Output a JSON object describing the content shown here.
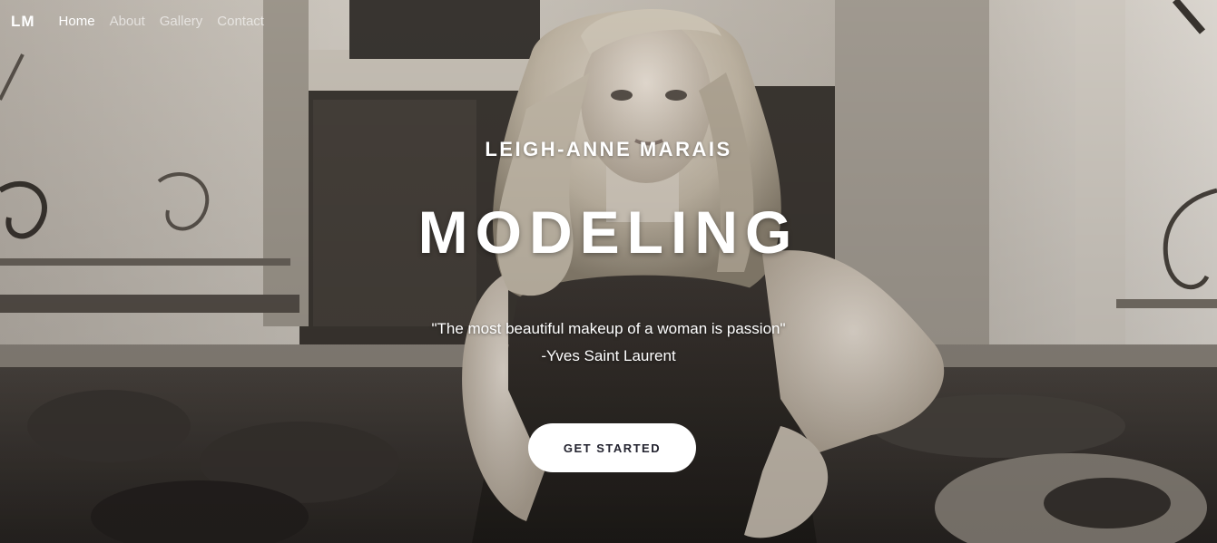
{
  "nav": {
    "logo": "LM",
    "links": [
      {
        "label": "Home",
        "active": true
      },
      {
        "label": "About",
        "active": false
      },
      {
        "label": "Gallery",
        "active": false
      },
      {
        "label": "Contact",
        "active": false
      }
    ]
  },
  "hero": {
    "name": "LEIGH-ANNE MARAIS",
    "headline": "MODELING",
    "quote": "\"The most beautiful makeup of a woman is passion\"",
    "quote_author": "-Yves Saint Laurent",
    "cta_label": "GET STARTED"
  },
  "colors": {
    "button_bg": "#ffffff",
    "button_text": "#23232f",
    "text": "#ffffff"
  }
}
